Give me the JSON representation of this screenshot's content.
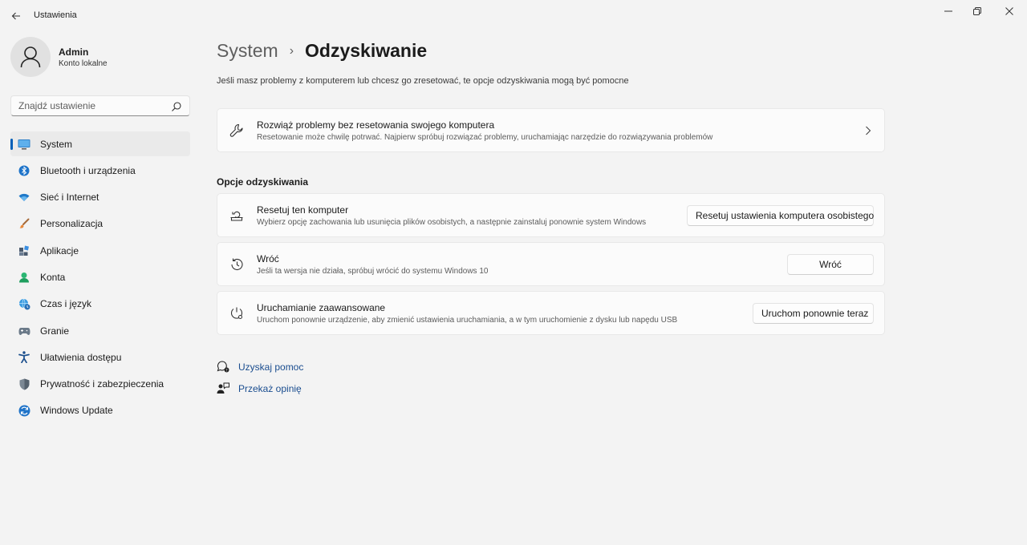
{
  "app": {
    "title": "Ustawienia"
  },
  "window_controls": {
    "minimize": "—",
    "restore": "❐",
    "close": "✕"
  },
  "profile": {
    "name": "Admin",
    "account_type": "Konto lokalne"
  },
  "search": {
    "placeholder": "Znajdź ustawienie"
  },
  "sidebar": {
    "items": [
      {
        "label": "System",
        "icon": "system-icon",
        "active": true
      },
      {
        "label": "Bluetooth i urządzenia",
        "icon": "bluetooth-icon"
      },
      {
        "label": "Sieć i Internet",
        "icon": "wifi-icon"
      },
      {
        "label": "Personalizacja",
        "icon": "brush-icon"
      },
      {
        "label": "Aplikacje",
        "icon": "apps-icon"
      },
      {
        "label": "Konta",
        "icon": "person-icon"
      },
      {
        "label": "Czas i język",
        "icon": "globe-clock-icon"
      },
      {
        "label": "Granie",
        "icon": "gamepad-icon"
      },
      {
        "label": "Ułatwienia dostępu",
        "icon": "accessibility-icon"
      },
      {
        "label": "Prywatność i zabezpieczenia",
        "icon": "shield-icon"
      },
      {
        "label": "Windows Update",
        "icon": "windows-update-icon"
      }
    ]
  },
  "breadcrumb": {
    "parent": "System",
    "separator": "›",
    "current": "Odzyskiwanie"
  },
  "subtitle": "Jeśli masz problemy z komputerem lub chcesz go zresetować, te opcje odzyskiwania mogą być pomocne",
  "troubleshoot_card": {
    "title": "Rozwiąż problemy bez resetowania swojego komputera",
    "description": "Resetowanie może chwilę potrwać. Najpierw spróbuj rozwiązać problemy, uruchamiając narzędzie do rozwiązywania problemów"
  },
  "section_title": "Opcje odzyskiwania",
  "options": [
    {
      "title": "Resetuj ten komputer",
      "description": "Wybierz opcję zachowania lub usunięcia plików osobistych, a następnie zainstaluj ponownie system Windows",
      "button": "Resetuj ustawienia komputera osobistego"
    },
    {
      "title": "Wróć",
      "description": "Jeśli ta wersja nie działa, spróbuj wrócić do systemu Windows 10",
      "button": "Wróć"
    },
    {
      "title": "Uruchamianie zaawansowane",
      "description": "Uruchom ponownie urządzenie, aby zmienić ustawienia uruchamiania, a w tym uruchomienie z dysku lub napędu USB",
      "button": "Uruchom ponownie teraz"
    }
  ],
  "links": {
    "help": "Uzyskaj pomoc",
    "feedback": "Przekaż opinię"
  },
  "colors": {
    "accent": "#005fb8",
    "link": "#1a4d8f",
    "background": "#f3f3f3",
    "card": "#fbfbfb"
  }
}
